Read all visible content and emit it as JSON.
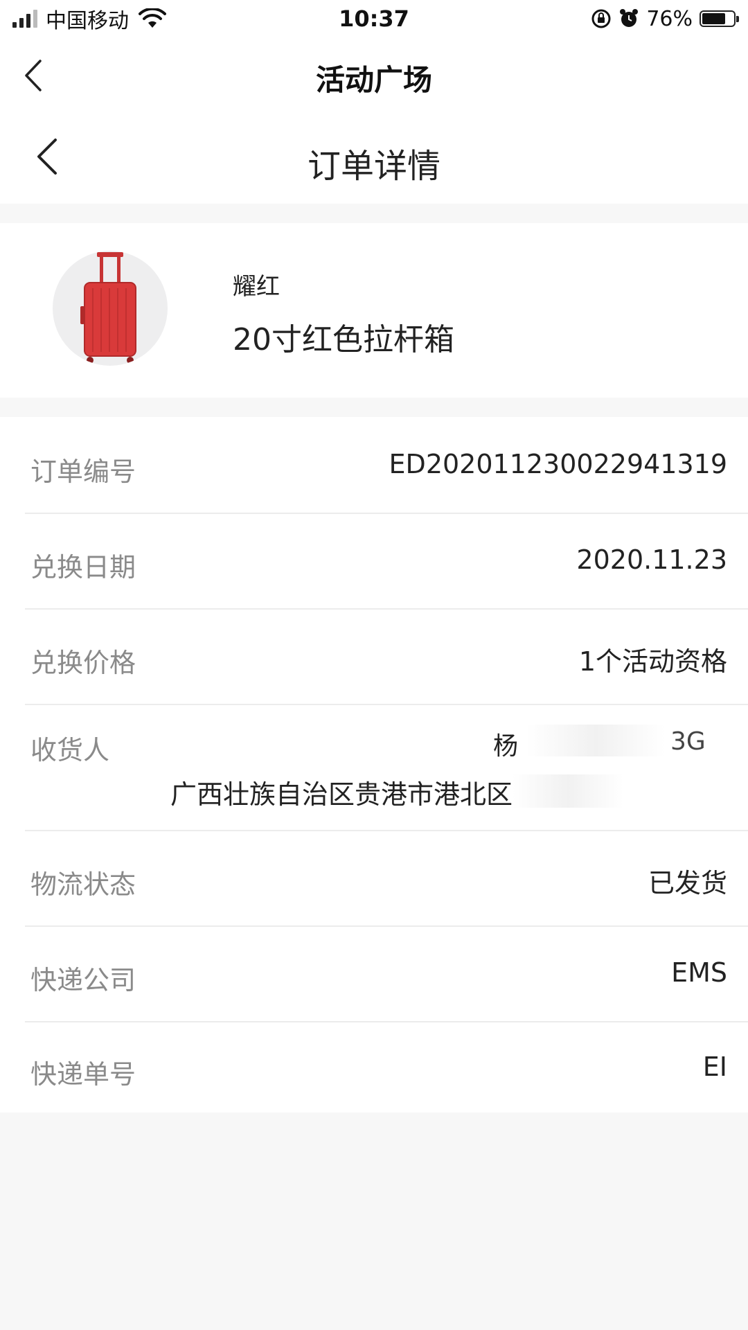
{
  "status_bar": {
    "carrier": "中国移动",
    "time": "10:37",
    "battery": "76%",
    "battery_level": 0.76
  },
  "nav_outer": {
    "title": "活动广场"
  },
  "nav_inner": {
    "title": "订单详情"
  },
  "product": {
    "brand": "耀红",
    "name": "20寸红色拉杆箱",
    "accent_color": "#d93a3a"
  },
  "details": {
    "order_no": {
      "label": "订单编号",
      "value": "ED202011230022941319"
    },
    "redeem_date": {
      "label": "兑换日期",
      "value": "2020.11.23"
    },
    "redeem_price": {
      "label": "兑换价格",
      "value": "1个活动资格"
    },
    "receiver": {
      "label": "收货人",
      "name": "杨",
      "phone": "3G",
      "address": "广西壮族自治区贵港市港北区"
    },
    "logistics_status": {
      "label": "物流状态",
      "value": "已发货"
    },
    "courier": {
      "label": "快递公司",
      "value": "EMS"
    },
    "tracking_no": {
      "label": "快递单号",
      "value": "EI"
    }
  }
}
